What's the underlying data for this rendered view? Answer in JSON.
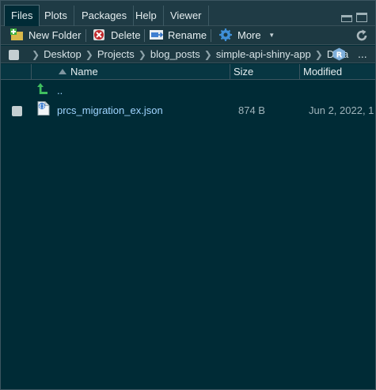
{
  "tabs": [
    {
      "label": "Files",
      "active": true
    },
    {
      "label": "Plots",
      "active": false
    },
    {
      "label": "Packages",
      "active": false
    },
    {
      "label": "Help",
      "active": false
    },
    {
      "label": "Viewer",
      "active": false
    }
  ],
  "toolbar": {
    "new_folder": "New Folder",
    "delete": "Delete",
    "rename": "Rename",
    "more": "More"
  },
  "breadcrumb": {
    "items": [
      "Desktop",
      "Projects",
      "blog_posts",
      "simple-api-shiny-app",
      "Data"
    ],
    "overflow": "..."
  },
  "columns": {
    "name": "Name",
    "size": "Size",
    "modified": "Modified"
  },
  "parent_row": {
    "label": ".."
  },
  "files": [
    {
      "name": "prcs_migration_ex.json",
      "size": "874 B",
      "modified": "Jun 2, 2022, 1"
    }
  ],
  "colors": {
    "background": "#002b36",
    "link": "#9fd4ff",
    "up_arrow": "#3fbf5f"
  }
}
